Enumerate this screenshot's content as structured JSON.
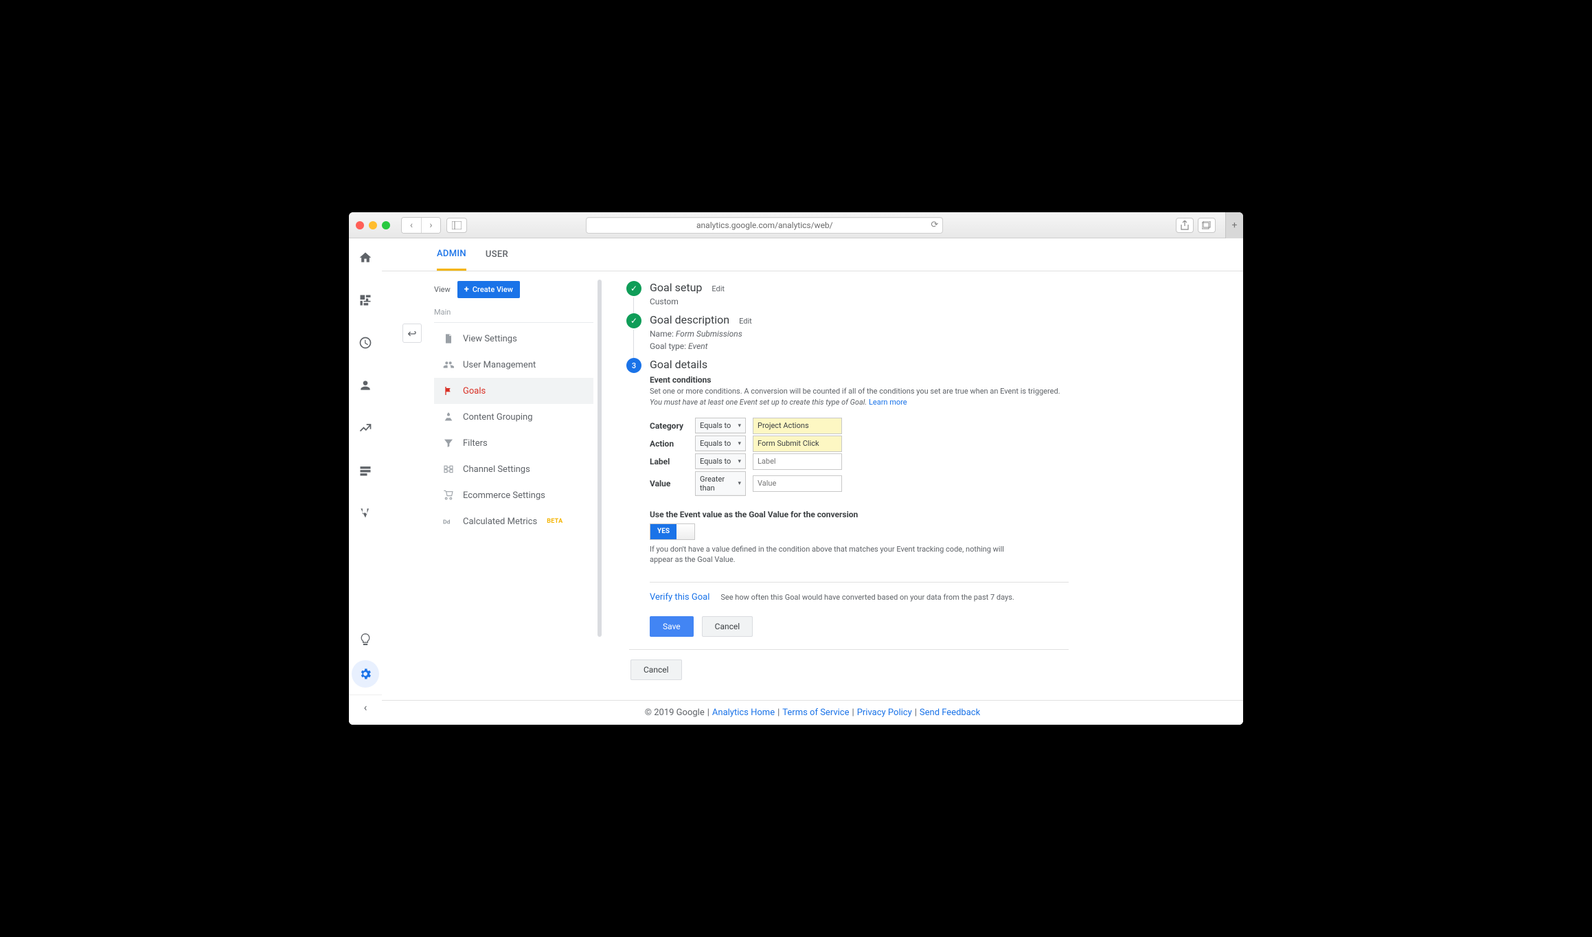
{
  "browser": {
    "url": "analytics.google.com/analytics/web/"
  },
  "tabs": {
    "admin": "ADMIN",
    "user": "USER"
  },
  "sidebar": {
    "view_label": "View",
    "create_view": "Create View",
    "main_label": "Main",
    "items": [
      {
        "label": "View Settings"
      },
      {
        "label": "User Management"
      },
      {
        "label": "Goals"
      },
      {
        "label": "Content Grouping"
      },
      {
        "label": "Filters"
      },
      {
        "label": "Channel Settings"
      },
      {
        "label": "Ecommerce Settings"
      },
      {
        "label": "Calculated Metrics",
        "badge": "BETA"
      }
    ]
  },
  "steps": {
    "setup": {
      "title": "Goal setup",
      "edit": "Edit",
      "sub": "Custom"
    },
    "description": {
      "title": "Goal description",
      "edit": "Edit",
      "name_label": "Name:",
      "name_value": "Form Submissions",
      "type_label": "Goal type:",
      "type_value": "Event"
    },
    "details": {
      "number": "3",
      "title": "Goal details",
      "section": "Event conditions",
      "help1": "Set one or more conditions. A conversion will be counted if all of the conditions you set are true when an Event is triggered.",
      "help2": "You must have at least one Event set up to create this type of Goal.",
      "learn_more": "Learn more",
      "rows": [
        {
          "label": "Category",
          "op": "Equals to",
          "value": "Project Actions",
          "highlight": true
        },
        {
          "label": "Action",
          "op": "Equals to",
          "value": "Form Submit Click",
          "highlight": true
        },
        {
          "label": "Label",
          "op": "Equals to",
          "placeholder": "Label"
        },
        {
          "label": "Value",
          "op": "Greater than",
          "placeholder": "Value"
        }
      ],
      "toggle_title": "Use the Event value as the Goal Value for the conversion",
      "toggle_value": "YES",
      "toggle_help": "If you don't have a value defined in the condition above that matches your Event tracking code, nothing will appear as the Goal Value.",
      "verify_link": "Verify this Goal",
      "verify_help": "See how often this Goal would have converted based on your data from the past 7 days.",
      "save": "Save",
      "cancel": "Cancel"
    },
    "outer_cancel": "Cancel"
  },
  "footer": {
    "copyright": "© 2019 Google",
    "links": [
      "Analytics Home",
      "Terms of Service",
      "Privacy Policy",
      "Send Feedback"
    ]
  }
}
